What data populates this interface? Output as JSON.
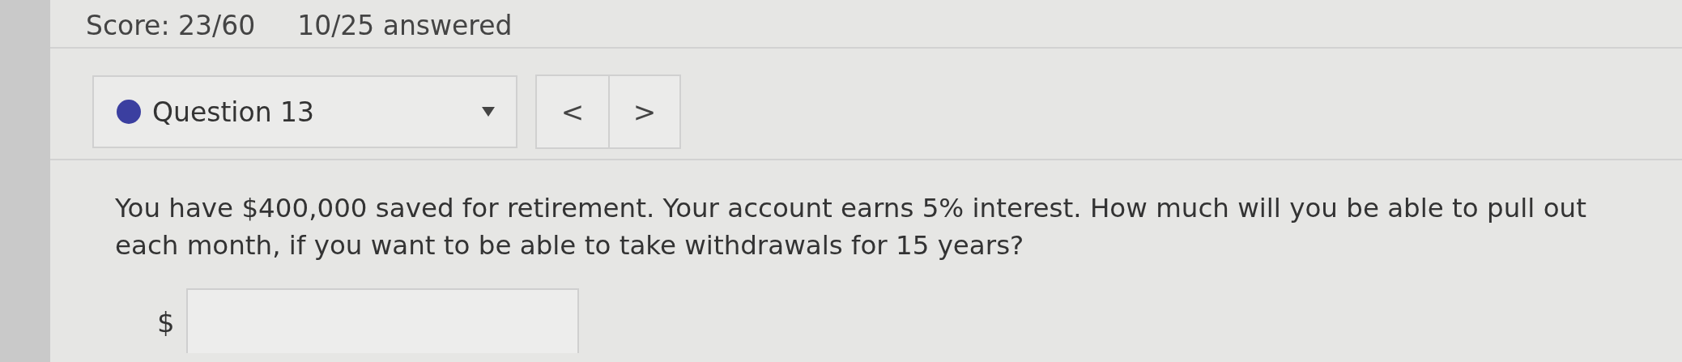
{
  "header": {
    "score": "Score: 23/60",
    "answered": "10/25 answered"
  },
  "question_selector": {
    "label": "Question 13",
    "completed": true
  },
  "nav": {
    "previous": "<",
    "next": ">"
  },
  "question": {
    "text": "You have $400,000 saved for retirement. Your account earns 5% interest. How much will you be able to pull out each month, if you want to be able to take withdrawals for 15 years?"
  },
  "answer": {
    "prefix": "$"
  }
}
